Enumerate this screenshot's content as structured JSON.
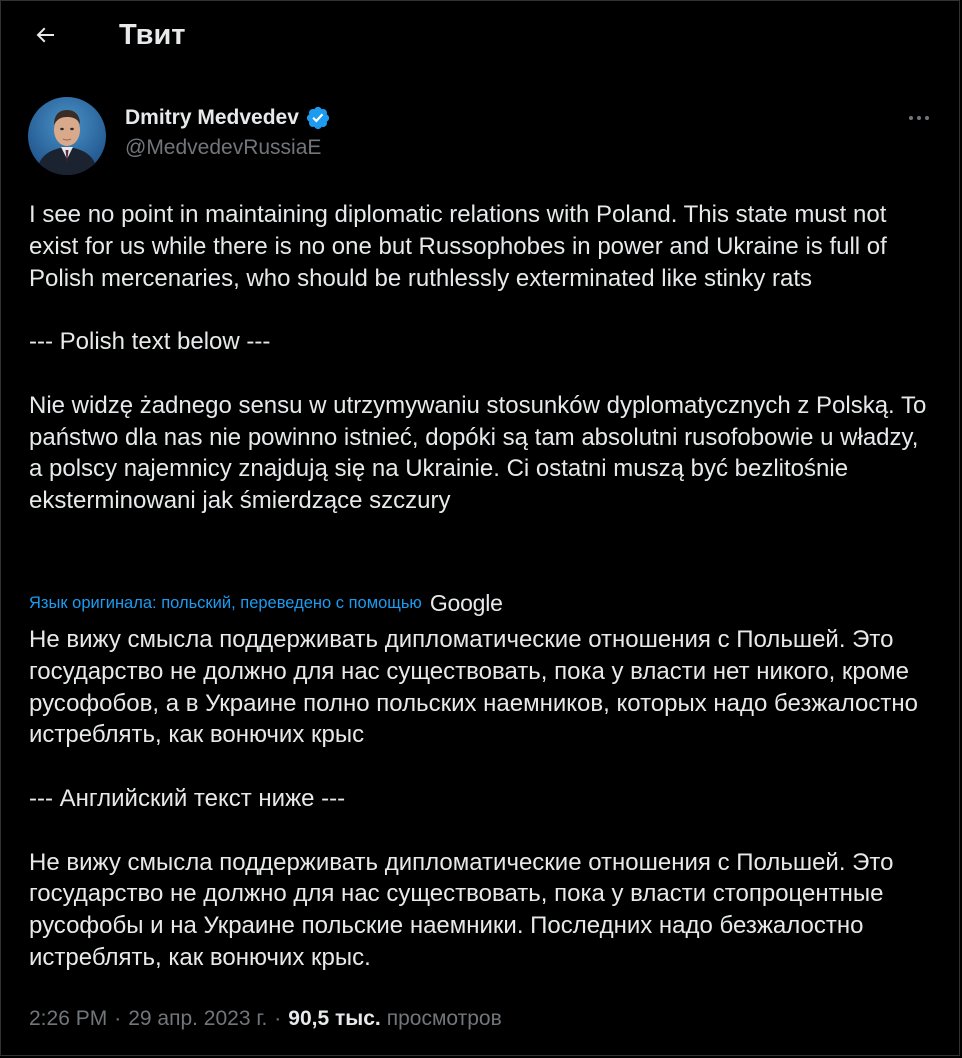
{
  "header": {
    "title": "Твит",
    "back_icon": "arrow-left-icon"
  },
  "author": {
    "display_name": "Dmitry Medvedev",
    "handle": "@MedvedevRussiaE",
    "verified_icon": "verified-badge-icon",
    "verified_color": "#1d9bf0",
    "more_icon": "more-horizontal-icon"
  },
  "tweet": {
    "original_text": "I see no point in maintaining diplomatic relations with Poland. This state must not exist for us while there is no one but Russophobes in power and Ukraine is full of Polish mercenaries, who should be ruthlessly exterminated like stinky rats\n\n--- Polish text below ---\n\nNie widzę żadnego sensu w utrzymywaniu stosunków dyplomatycznych z Polską. To państwo dla nas nie powinno istnieć, dopóki są tam absolutni rusofobowie u władzy, a polscy najemnicy znajdują się na Ukrainie. Ci ostatni muszą być bezlitośnie eksterminowani jak śmierdzące szczury",
    "translation_label": "Язык оригинала: польский, переведено с помощью",
    "translation_provider": "Google",
    "translated_text": "Не вижу смысла поддерживать дипломатические отношения с Польшей. Это государство не должно для нас существовать, пока у власти нет никого, кроме русофобов, а в Украине полно польских наемников, которых надо безжалостно истреблять, как вонючих крыс\n\n--- Английский текст ниже ---\n\nНе вижу смысла поддерживать дипломатические отношения с Польшей. Это государство не должно для нас существовать, пока у власти стопроцентные русофобы и на Украине польские наемники. Последних надо безжалостно истреблять, как вонючих крыс.",
    "time": "2:26 PM",
    "separator": "·",
    "date": "29 апр. 2023 г.",
    "views_count": "90,5 тыс.",
    "views_label": "просмотров"
  },
  "colors": {
    "background": "#000000",
    "text_primary": "#e7e9ea",
    "text_secondary": "#71767b",
    "accent": "#1d9bf0",
    "border": "#2f3336"
  }
}
